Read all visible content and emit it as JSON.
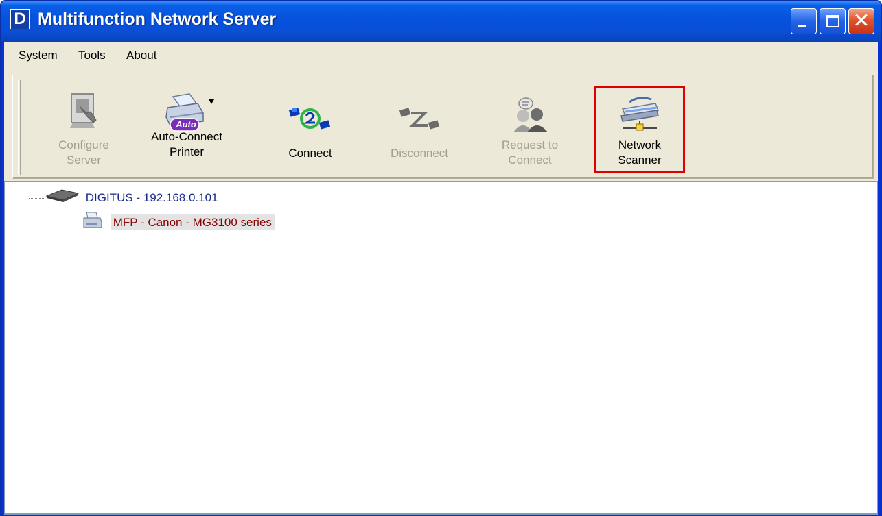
{
  "window": {
    "title": "Multifunction Network Server",
    "app_icon_letter": "D"
  },
  "menubar": {
    "items": [
      "System",
      "Tools",
      "About"
    ]
  },
  "toolbar": {
    "buttons": [
      {
        "label_line1": "Configure",
        "label_line2": "Server",
        "enabled": false,
        "icon": "configure-server-icon"
      },
      {
        "label_line1": "Auto-Connect",
        "label_line2": "Printer",
        "enabled": true,
        "icon": "auto-connect-printer-icon",
        "badge": "Auto"
      },
      {
        "label_line1": "Connect",
        "label_line2": "",
        "enabled": true,
        "icon": "connect-icon"
      },
      {
        "label_line1": "Disconnect",
        "label_line2": "",
        "enabled": false,
        "icon": "disconnect-icon"
      },
      {
        "label_line1": "Request to",
        "label_line2": "Connect",
        "enabled": false,
        "icon": "request-to-connect-icon"
      },
      {
        "label_line1": "Network",
        "label_line2": "Scanner",
        "enabled": true,
        "icon": "network-scanner-icon",
        "highlighted": true
      }
    ]
  },
  "tree": {
    "server": "DIGITUS - 192.168.0.101",
    "device": "MFP - Canon - MG3100 series"
  },
  "colors": {
    "titlebar": "#0a5fe6",
    "client_bg": "#ece9d8",
    "highlight": "#e00000",
    "server_text": "#1a2a8a",
    "device_text": "#8b0000"
  }
}
